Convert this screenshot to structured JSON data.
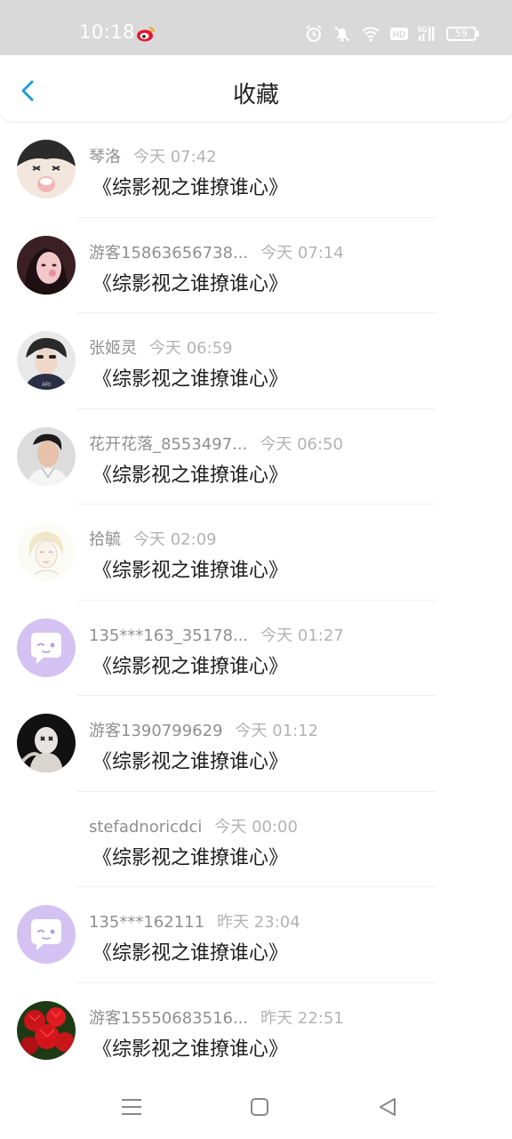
{
  "status_bar": {
    "time": "10:18",
    "battery": "59",
    "icons": [
      "weibo-icon",
      "alarm-icon",
      "mute-icon",
      "wifi-icon",
      "hd-icon",
      "5g-signal-icon",
      "battery-icon"
    ]
  },
  "header": {
    "title": "收藏",
    "back_icon": "chevron-left-icon",
    "accent": "#1e9bd7"
  },
  "items": [
    {
      "name": "琴洛",
      "time": "今天 07:42",
      "title": "《综影视之谁撩谁心》",
      "avatar": "anime-crying"
    },
    {
      "name": "游客15863656738...",
      "time": "今天 07:14",
      "title": "《综影视之谁撩谁心》",
      "avatar": "woman-photo"
    },
    {
      "name": "张姬灵",
      "time": "今天 06:59",
      "title": "《综影视之谁撩谁心》",
      "avatar": "person-photo"
    },
    {
      "name": "花开花落_8553497...",
      "time": "今天 06:50",
      "title": "《综影视之谁撩谁心》",
      "avatar": "man-photo"
    },
    {
      "name": "拾毓",
      "time": "今天 02:09",
      "title": "《综影视之谁撩谁心》",
      "avatar": "sketch-girl"
    },
    {
      "name": "135***163_35178...",
      "time": "今天 01:27",
      "title": "《综影视之谁撩谁心》",
      "avatar": "default-chat"
    },
    {
      "name": "游客1390799629",
      "time": "今天 01:12",
      "title": "《综影视之谁撩谁心》",
      "avatar": "dark-figure"
    },
    {
      "name": "stefadnoricdci",
      "time": "今天 00:00",
      "title": "《综影视之谁撩谁心》",
      "avatar": "none"
    },
    {
      "name": "135***162111",
      "time": "昨天 23:04",
      "title": "《综影视之谁撩谁心》",
      "avatar": "default-chat"
    },
    {
      "name": "游客15550683516...",
      "time": "昨天 22:51",
      "title": "《综影视之谁撩谁心》",
      "avatar": "red-flowers"
    }
  ],
  "nav_bar": {
    "icons": [
      "menu-icon",
      "home-square-icon",
      "back-triangle-icon"
    ]
  }
}
